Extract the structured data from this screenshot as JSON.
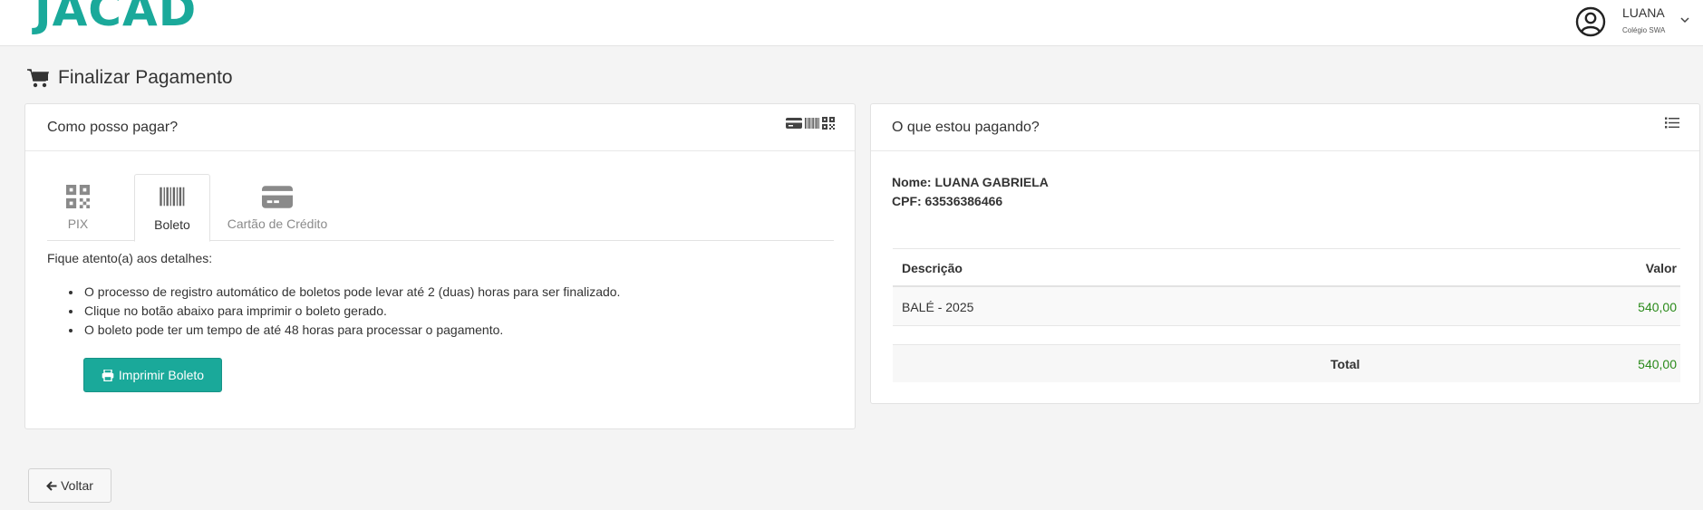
{
  "header": {
    "logo": "JACAD",
    "user_name": "LUANA",
    "user_school": "Colégio SWA",
    "user_icon": "user-circle-icon",
    "menu_icon": "chevron-down-icon"
  },
  "page": {
    "title": "Finalizar Pagamento",
    "title_icon": "shopping-cart-icon"
  },
  "payment_panel": {
    "title": "Como posso pagar?",
    "header_icons": [
      "credit-card-icon",
      "barcode-icon",
      "qrcode-icon"
    ],
    "tabs": [
      {
        "label": "PIX",
        "icon": "qrcode-icon",
        "active": false
      },
      {
        "label": "Boleto",
        "icon": "barcode-icon",
        "active": true
      },
      {
        "label": "Cartão de Crédito",
        "icon": "credit-card-icon",
        "active": false
      }
    ],
    "details_title": "Fique atento(a) aos detalhes:",
    "details": [
      "O processo de registro automático de boletos pode levar até 2 (duas) horas para ser finalizado.",
      "Clique no botão abaixo para imprimir o boleto gerado.",
      "O boleto pode ter um tempo de até 48 horas para processar o pagamento."
    ],
    "print_button": "Imprimir Boleto"
  },
  "summary_panel": {
    "title": "O que estou pagando?",
    "header_icon": "list-icon",
    "name_line": "Nome: LUANA GABRIELA",
    "cpf_line": "CPF: 63536386466",
    "table": {
      "headers": [
        "Descrição",
        "Valor"
      ],
      "rows": [
        [
          "BALÉ - 2025",
          "540,00"
        ]
      ],
      "total_label": "Total",
      "total_value": "540,00"
    }
  },
  "footer": {
    "back_button": "Voltar"
  },
  "colors": {
    "accent": "#1aa99a",
    "value_green": "#2a8a1a",
    "background": "#f4f4f4"
  }
}
